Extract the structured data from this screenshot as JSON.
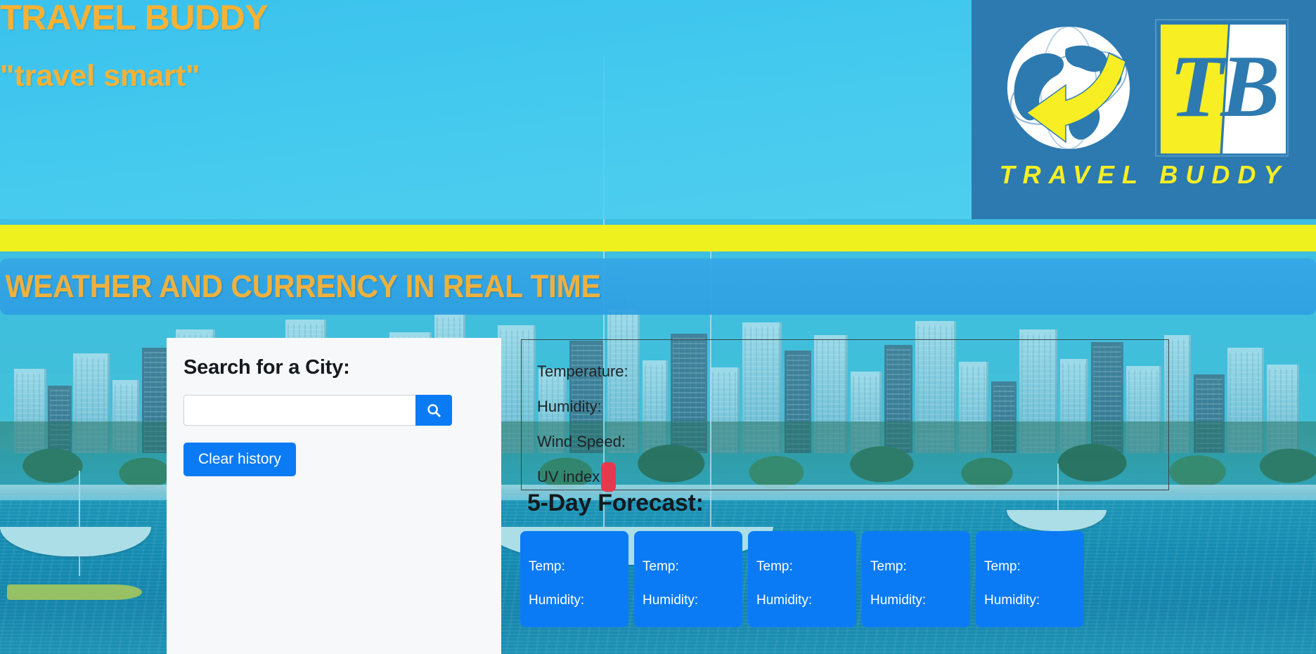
{
  "header": {
    "brand_title": "TRAVEL BUDDY",
    "tagline": "\"travel smart\"",
    "logo": {
      "mark_text": "TB",
      "caption": "TRAVEL BUDDY",
      "globe_icon": "globe-arrow-icon",
      "panel_color": "#2d7ab0",
      "yellow": "#f7ef23"
    }
  },
  "divider": {
    "color": "#eff11f"
  },
  "section": {
    "banner_title": "WEATHER AND CURRENCY IN REAL TIME",
    "banner_color": "#2f9fe2",
    "title_color": "#f9b133"
  },
  "search": {
    "heading": "Search for a City:",
    "input_value": "",
    "input_placeholder": "",
    "search_icon": "search-icon",
    "clear_label": "Clear history",
    "button_color": "#0b7bf5",
    "history_items": []
  },
  "weather": {
    "lines": [
      {
        "label": "Temperature:",
        "value": ""
      },
      {
        "label": "Humidity:",
        "value": ""
      },
      {
        "label": "Wind Speed:",
        "value": ""
      },
      {
        "label": "UV index:",
        "value": ""
      }
    ],
    "uv_badge_color": "#e8384f"
  },
  "forecast": {
    "heading": "5-Day Forecast:",
    "card_color": "#0b7bf5",
    "cards": [
      {
        "temp_label": "Temp:",
        "temp_value": "",
        "humidity_label": "Humidity:",
        "humidity_value": ""
      },
      {
        "temp_label": "Temp:",
        "temp_value": "",
        "humidity_label": "Humidity:",
        "humidity_value": ""
      },
      {
        "temp_label": "Temp:",
        "temp_value": "",
        "humidity_label": "Humidity:",
        "humidity_value": ""
      },
      {
        "temp_label": "Temp:",
        "temp_value": "",
        "humidity_label": "Humidity:",
        "humidity_value": ""
      },
      {
        "temp_label": "Temp:",
        "temp_value": "",
        "humidity_label": "Humidity:",
        "humidity_value": ""
      }
    ]
  },
  "background": {
    "description": "miami-waterfront-photo"
  }
}
